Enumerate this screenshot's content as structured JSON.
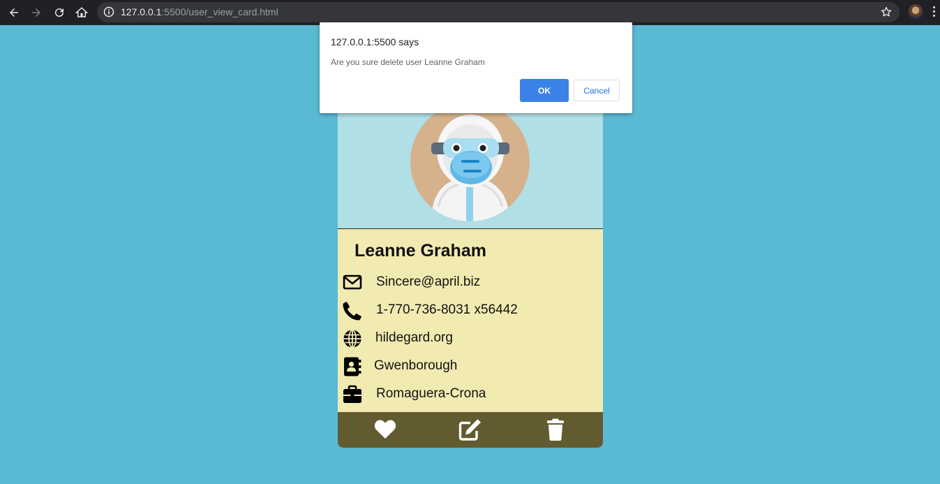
{
  "browser": {
    "url_host": "127.0.0.1",
    "url_rest": ":5500/user_view_card.html"
  },
  "dialog": {
    "origin": "127.0.0.1:5500 says",
    "message": "Are you sure delete user Leanne Graham",
    "ok_label": "OK",
    "cancel_label": "Cancel"
  },
  "user": {
    "name": "Leanne Graham",
    "email": "Sincere@april.biz",
    "phone": "1-770-736-8031 x56442",
    "website": "hildegard.org",
    "city": "Gwenborough",
    "company": "Romaguera-Crona"
  },
  "icons": {
    "email": "envelope-icon",
    "phone": "phone-icon",
    "website": "globe-icon",
    "city": "address-book-icon",
    "company": "briefcase-icon",
    "like": "heart-icon",
    "edit": "edit-icon",
    "delete": "trash-icon"
  },
  "colors": {
    "page_background": "#5bbad3",
    "card_header": "#b1dfe6",
    "card_body": "#f2ebb1",
    "card_footer": "#625b30",
    "ok_button": "#3b82e8"
  }
}
